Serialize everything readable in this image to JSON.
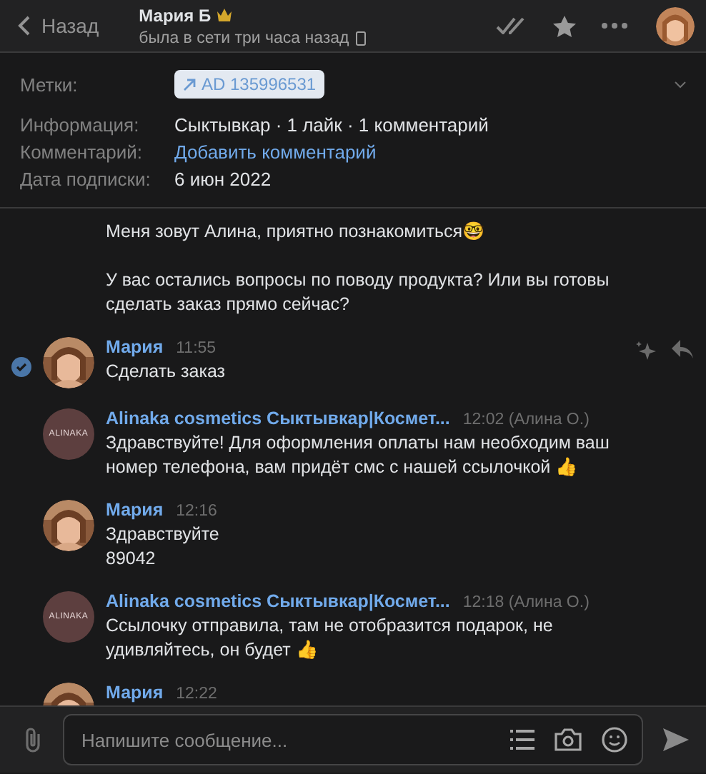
{
  "header": {
    "back_label": "Назад",
    "name": "Мария Б",
    "status": "была в сети три часа назад"
  },
  "info": {
    "tags_label": "Метки:",
    "tag": "AD 135996531",
    "rows": [
      {
        "label": "Информация:",
        "value": "Сыктывкар · 1 лайк · 1 комментарий",
        "kind": "text"
      },
      {
        "label": "Комментарий:",
        "value": "Добавить комментарий",
        "kind": "link"
      },
      {
        "label": "Дата подписки:",
        "value": "6 июн 2022",
        "kind": "text"
      }
    ]
  },
  "messages": [
    {
      "kind": "continuation",
      "selected": false,
      "lines": [
        "Меня зовут Алина, приятно познакомиться🤓",
        "У вас остались вопросы по поводу продукта? Или вы готовы сделать заказ прямо сейчас?"
      ]
    },
    {
      "kind": "person",
      "selected": true,
      "author": "Мария",
      "time": "11:55",
      "lines": [
        "Сделать заказ"
      ]
    },
    {
      "kind": "shop",
      "selected": false,
      "author": "Alinaka cosmetics Сыктывкар|Космет...",
      "avatar_text": "ALINAKA",
      "time": "12:02 (Алина О.)",
      "lines": [
        "Здравствуйте! Для оформления оплаты нам необходим ваш номер телефона, вам придёт смс с нашей ссылочкой 👍"
      ]
    },
    {
      "kind": "person",
      "selected": false,
      "author": "Мария",
      "time": "12:16",
      "lines": [
        "Здравствуйте",
        "89042"
      ]
    },
    {
      "kind": "shop",
      "selected": false,
      "author": "Alinaka cosmetics Сыктывкар|Космет...",
      "avatar_text": "ALINAKA",
      "time": "12:18 (Алина О.)",
      "lines": [
        "Ссылочку отправила, там не отобразится подарок, не удивляйтесь, он будет 👍"
      ]
    },
    {
      "kind": "person",
      "selected": false,
      "author": "Мария",
      "time": "12:22"
    }
  ],
  "composer": {
    "placeholder": "Напишите сообщение..."
  }
}
